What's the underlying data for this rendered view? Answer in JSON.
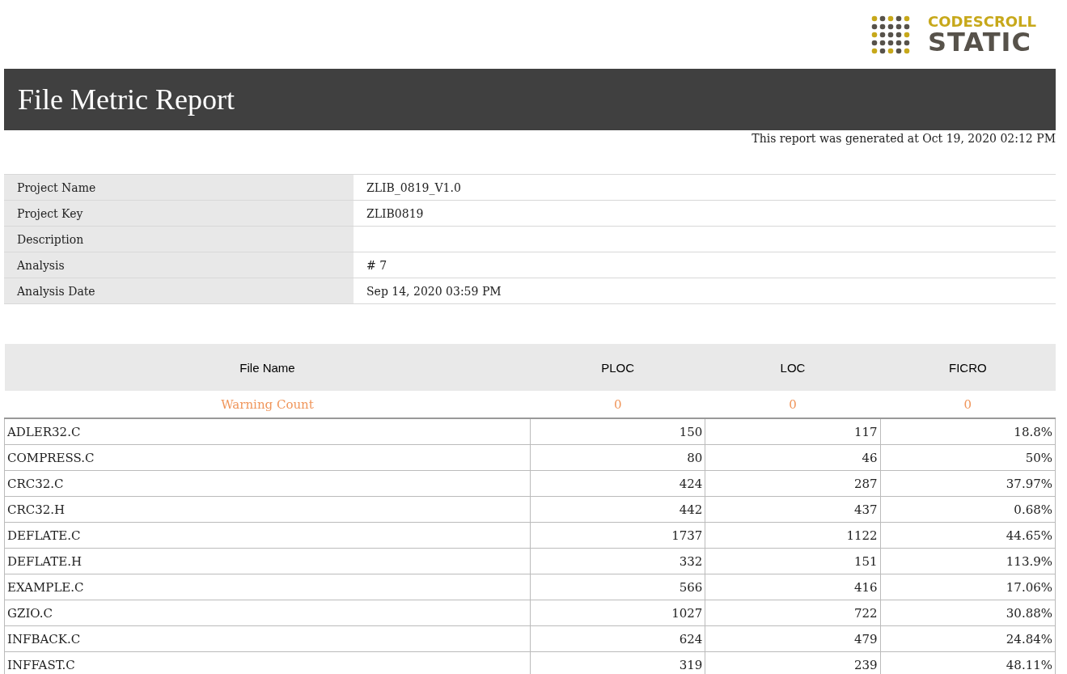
{
  "logo": {
    "brand": "CODESCROLL",
    "product": "STATIC"
  },
  "title": "File Metric Report",
  "generated": "This report was generated at Oct 19, 2020 02:12 PM",
  "info": [
    {
      "label": "Project Name",
      "value": "ZLIB_0819_V1.0"
    },
    {
      "label": "Project Key",
      "value": "ZLIB0819"
    },
    {
      "label": "Description"
    },
    {
      "label": "Analysis",
      "value": "# 7"
    },
    {
      "label": "Analysis Date",
      "value": "Sep 14, 2020 03:59 PM"
    }
  ],
  "table": {
    "columns": [
      "File Name",
      "PLOC",
      "LOC",
      "FICRO"
    ],
    "warning_row": [
      "Warning Count",
      "0",
      "0",
      "0"
    ],
    "rows": [
      [
        "ADLER32.C",
        "150",
        "117",
        "18.8%"
      ],
      [
        "COMPRESS.C",
        "80",
        "46",
        "50%"
      ],
      [
        "CRC32.C",
        "424",
        "287",
        "37.97%"
      ],
      [
        "CRC32.H",
        "442",
        "437",
        "0.68%"
      ],
      [
        "DEFLATE.C",
        "1737",
        "1122",
        "44.65%"
      ],
      [
        "DEFLATE.H",
        "332",
        "151",
        "113.9%"
      ],
      [
        "EXAMPLE.C",
        "566",
        "416",
        "17.06%"
      ],
      [
        "GZIO.C",
        "1027",
        "722",
        "30.88%"
      ],
      [
        "INFBACK.C",
        "624",
        "479",
        "24.84%"
      ],
      [
        "INFFAST.C",
        "319",
        "239",
        "48.11%"
      ]
    ]
  }
}
